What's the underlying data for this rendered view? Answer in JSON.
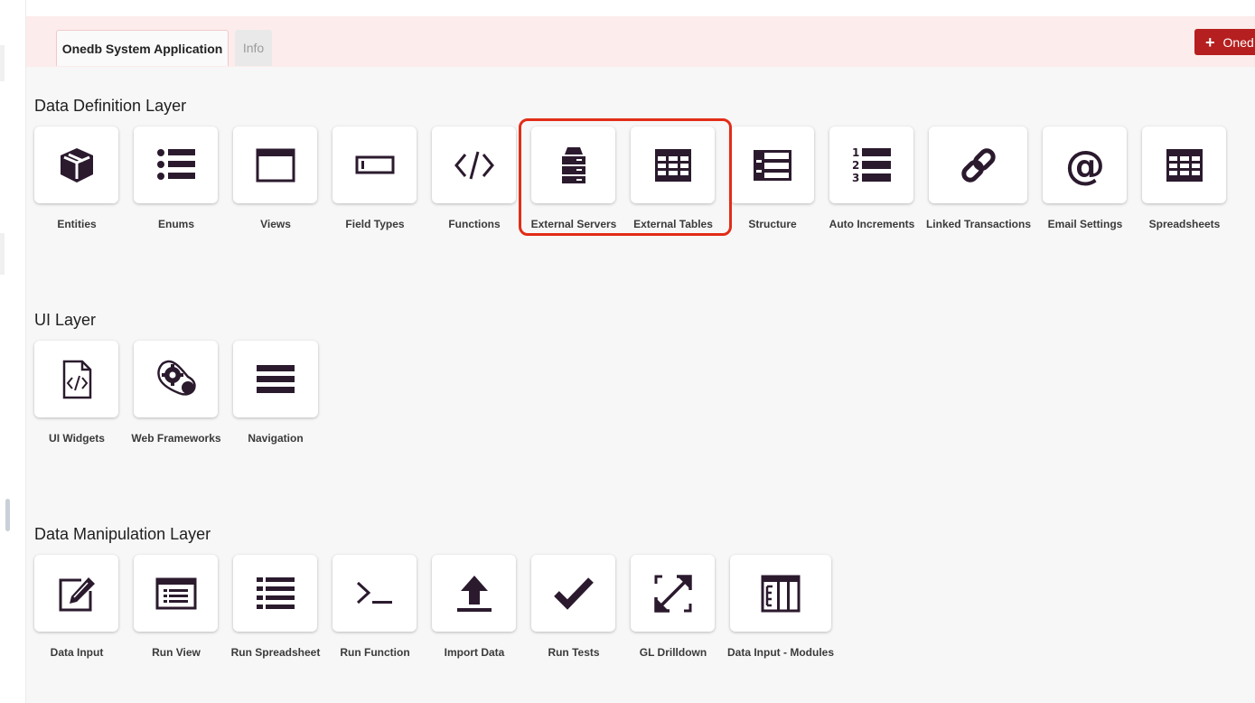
{
  "tabs": [
    {
      "label": "Onedb System Application",
      "active": true
    },
    {
      "label": "Info",
      "active": false
    }
  ],
  "add_button": {
    "label": "Oned",
    "icon": "plus-icon"
  },
  "colors": {
    "accent": "#b61f1f",
    "highlight": "#e22d18",
    "icon": "#2b1a2e",
    "topbar": "#fdecec"
  },
  "sections": [
    {
      "title": "Data Definition Layer",
      "items": [
        {
          "label": "Entities",
          "icon": "cube-icon"
        },
        {
          "label": "Enums",
          "icon": "list-icon"
        },
        {
          "label": "Views",
          "icon": "window-icon"
        },
        {
          "label": "Field Types",
          "icon": "text-field-icon"
        },
        {
          "label": "Functions",
          "icon": "code-icon"
        },
        {
          "label": "External Servers",
          "icon": "server-icon"
        },
        {
          "label": "External Tables",
          "icon": "table-icon"
        },
        {
          "label": "Structure",
          "icon": "structure-icon"
        },
        {
          "label": "Auto Increments",
          "icon": "numbered-list-icon"
        },
        {
          "label": "Linked Transactions",
          "icon": "link-icon"
        },
        {
          "label": "Email Settings",
          "icon": "at-sign-icon"
        },
        {
          "label": "Spreadsheets",
          "icon": "spreadsheet-icon"
        }
      ]
    },
    {
      "title": "UI Layer",
      "items": [
        {
          "label": "UI Widgets",
          "icon": "code-file-icon"
        },
        {
          "label": "Web Frameworks",
          "icon": "gears-icon"
        },
        {
          "label": "Navigation",
          "icon": "menu-bars-icon"
        }
      ]
    },
    {
      "title": "Data Manipulation Layer",
      "items": [
        {
          "label": "Data Input",
          "icon": "edit-icon"
        },
        {
          "label": "Run View",
          "icon": "list-window-icon"
        },
        {
          "label": "Run Spreadsheet",
          "icon": "list-icon"
        },
        {
          "label": "Run Function",
          "icon": "terminal-icon"
        },
        {
          "label": "Import Data",
          "icon": "upload-icon"
        },
        {
          "label": "Run Tests",
          "icon": "check-icon"
        },
        {
          "label": "GL Drilldown",
          "icon": "expand-arrows-icon"
        },
        {
          "label": "Data Input - Modules",
          "icon": "columns-icon"
        }
      ]
    }
  ]
}
